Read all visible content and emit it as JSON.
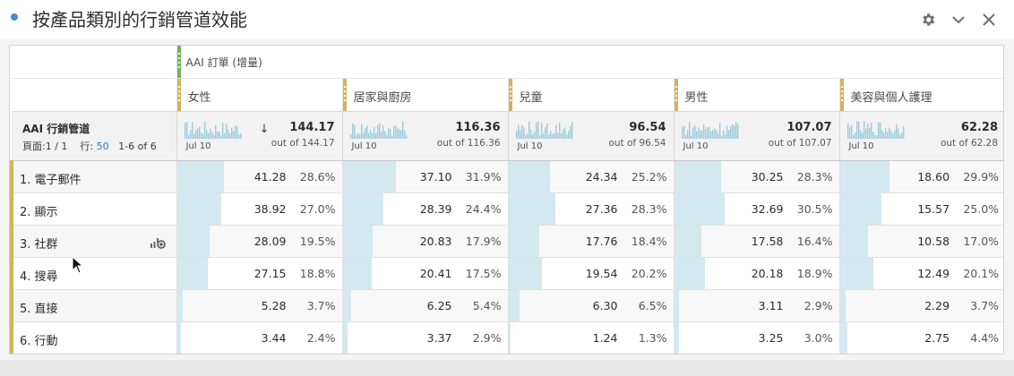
{
  "panel": {
    "title": "按產品類別的行銷管道效能",
    "icons": [
      "gear-icon",
      "chevron-down-icon",
      "close-icon"
    ]
  },
  "table": {
    "metric": "AAI 訂單 (增量)",
    "dimension": "AAI 行銷管道",
    "pager": {
      "page_label": "頁面:",
      "page_value": "1 / 1",
      "rows_label": "行:",
      "rows_value": "50",
      "range": "1-6 of 6"
    },
    "sort_indicator": "↓",
    "segments": [
      {
        "label": "女性",
        "total": "144.17",
        "out_of": "out of 144.17",
        "date": "Jul 10"
      },
      {
        "label": "居家與廚房",
        "total": "116.36",
        "out_of": "out of 116.36",
        "date": "Jul 10"
      },
      {
        "label": "兒童",
        "total": "96.54",
        "out_of": "out of 96.54",
        "date": "Jul 10"
      },
      {
        "label": "男性",
        "total": "107.07",
        "out_of": "out of 107.07",
        "date": "Jul 10"
      },
      {
        "label": "美容與個人護理",
        "total": "62.28",
        "out_of": "out of 62.28",
        "date": "Jul 10"
      }
    ],
    "rows": [
      {
        "label": "1. 電子郵件",
        "cells": [
          {
            "value": "41.28",
            "pct": "28.6%",
            "share": 0.286
          },
          {
            "value": "37.10",
            "pct": "31.9%",
            "share": 0.319
          },
          {
            "value": "24.34",
            "pct": "25.2%",
            "share": 0.252
          },
          {
            "value": "30.25",
            "pct": "28.3%",
            "share": 0.283
          },
          {
            "value": "18.60",
            "pct": "29.9%",
            "share": 0.299
          }
        ]
      },
      {
        "label": "2. 顯示",
        "cells": [
          {
            "value": "38.92",
            "pct": "27.0%",
            "share": 0.27
          },
          {
            "value": "28.39",
            "pct": "24.4%",
            "share": 0.244
          },
          {
            "value": "27.36",
            "pct": "28.3%",
            "share": 0.283
          },
          {
            "value": "32.69",
            "pct": "30.5%",
            "share": 0.305
          },
          {
            "value": "15.57",
            "pct": "25.0%",
            "share": 0.25
          }
        ]
      },
      {
        "label": "3. 社群",
        "cells": [
          {
            "value": "28.09",
            "pct": "19.5%",
            "share": 0.195
          },
          {
            "value": "20.83",
            "pct": "17.9%",
            "share": 0.179
          },
          {
            "value": "17.76",
            "pct": "18.4%",
            "share": 0.184
          },
          {
            "value": "17.58",
            "pct": "16.4%",
            "share": 0.164
          },
          {
            "value": "10.58",
            "pct": "17.0%",
            "share": 0.17
          }
        ]
      },
      {
        "label": "4. 搜尋",
        "cells": [
          {
            "value": "27.15",
            "pct": "18.8%",
            "share": 0.188
          },
          {
            "value": "20.41",
            "pct": "17.5%",
            "share": 0.175
          },
          {
            "value": "19.54",
            "pct": "20.2%",
            "share": 0.202
          },
          {
            "value": "20.18",
            "pct": "18.9%",
            "share": 0.189
          },
          {
            "value": "12.49",
            "pct": "20.1%",
            "share": 0.201
          }
        ]
      },
      {
        "label": "5. 直接",
        "cells": [
          {
            "value": "5.28",
            "pct": "3.7%",
            "share": 0.037
          },
          {
            "value": "6.25",
            "pct": "5.4%",
            "share": 0.054
          },
          {
            "value": "6.30",
            "pct": "6.5%",
            "share": 0.065
          },
          {
            "value": "3.11",
            "pct": "2.9%",
            "share": 0.029
          },
          {
            "value": "2.29",
            "pct": "3.7%",
            "share": 0.037
          }
        ]
      },
      {
        "label": "6. 行動",
        "cells": [
          {
            "value": "3.44",
            "pct": "2.4%",
            "share": 0.024
          },
          {
            "value": "3.37",
            "pct": "2.9%",
            "share": 0.029
          },
          {
            "value": "1.24",
            "pct": "1.3%",
            "share": 0.013
          },
          {
            "value": "3.25",
            "pct": "3.0%",
            "share": 0.03
          },
          {
            "value": "2.75",
            "pct": "4.4%",
            "share": 0.044
          }
        ]
      }
    ]
  },
  "colors": {
    "accent": "#4a89dc",
    "bar": "#d4e8ef",
    "sparkline": "#9ccbdb",
    "metric_handle": "#6fb35f",
    "segment_handle": "#d3b35e"
  }
}
